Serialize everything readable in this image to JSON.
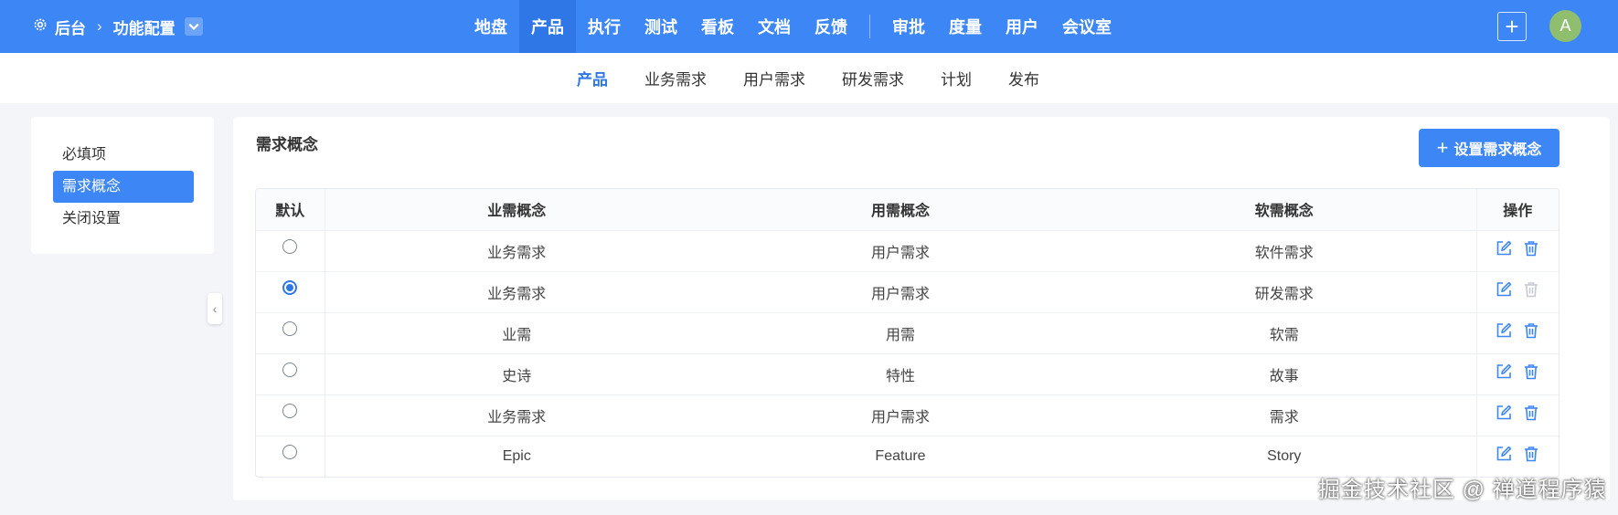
{
  "topbar": {
    "breadcrumb_root": "后台",
    "breadcrumb_current": "功能配置",
    "nav": [
      {
        "label": "地盘"
      },
      {
        "label": "产品"
      },
      {
        "label": "执行"
      },
      {
        "label": "测试"
      },
      {
        "label": "看板"
      },
      {
        "label": "文档"
      },
      {
        "label": "反馈"
      },
      {
        "label": "审批"
      },
      {
        "label": "度量"
      },
      {
        "label": "用户"
      },
      {
        "label": "会议室"
      }
    ],
    "active_nav": "产品",
    "add_label": "+",
    "avatar_letter": "A"
  },
  "subnav": {
    "items": [
      {
        "label": "产品"
      },
      {
        "label": "业务需求"
      },
      {
        "label": "用户需求"
      },
      {
        "label": "研发需求"
      },
      {
        "label": "计划"
      },
      {
        "label": "发布"
      }
    ],
    "active": "产品"
  },
  "sidebar": {
    "items": [
      {
        "label": "必填项"
      },
      {
        "label": "需求概念"
      },
      {
        "label": "关闭设置"
      }
    ],
    "active": "需求概念"
  },
  "main": {
    "title": "需求概念",
    "set_button_label": "设置需求概念",
    "columns": {
      "default": "默认",
      "business": "业需概念",
      "user": "用需概念",
      "software": "软需概念",
      "actions": "操作"
    },
    "rows": [
      {
        "default": false,
        "business": "业务需求",
        "user": "用户需求",
        "software": "软件需求",
        "deletable": true
      },
      {
        "default": true,
        "business": "业务需求",
        "user": "用户需求",
        "software": "研发需求",
        "deletable": false
      },
      {
        "default": false,
        "business": "业需",
        "user": "用需",
        "software": "软需",
        "deletable": true
      },
      {
        "default": false,
        "business": "史诗",
        "user": "特性",
        "software": "故事",
        "deletable": true
      },
      {
        "default": false,
        "business": "业务需求",
        "user": "用户需求",
        "software": "需求",
        "deletable": true
      },
      {
        "default": false,
        "business": "Epic",
        "user": "Feature",
        "software": "Story",
        "deletable": true
      }
    ]
  },
  "watermark": "掘金技术社区 @ 禅道程序猿",
  "colors": {
    "primary": "#3d86f5",
    "primary_dark": "#2f77e6",
    "avatar_bg": "#8fbf6e",
    "disabled_icon": "#c7cbd1"
  }
}
